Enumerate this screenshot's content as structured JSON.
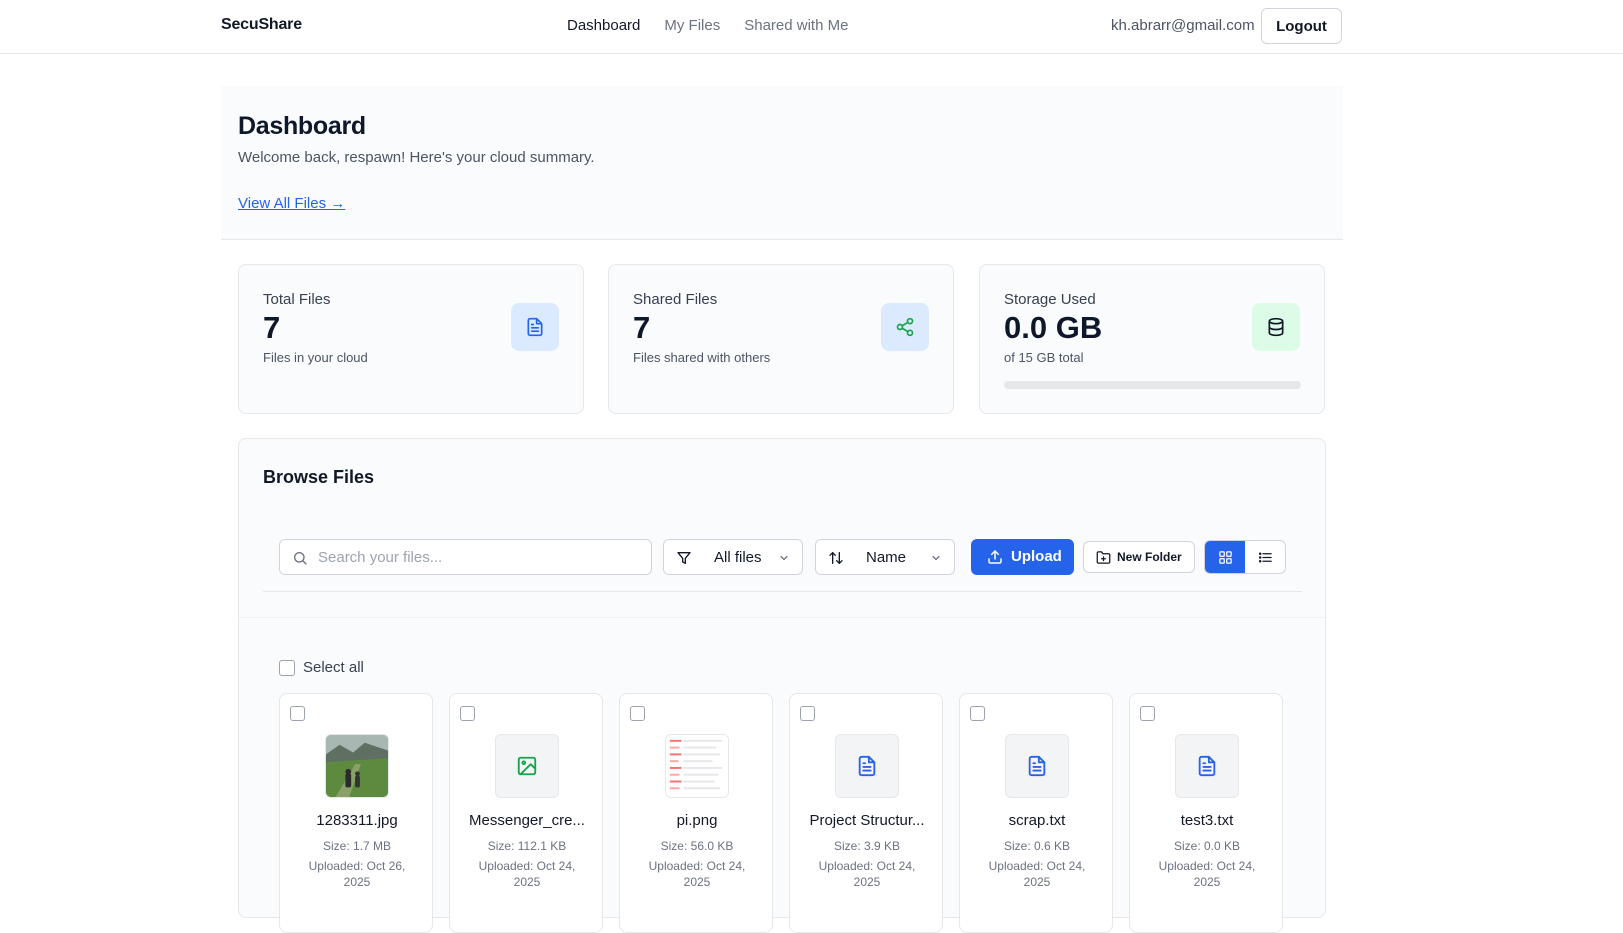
{
  "nav": {
    "brand": "SecuShare",
    "links": [
      "Dashboard",
      "My Files",
      "Shared with Me"
    ],
    "user_email": "kh.abrarr@gmail.com",
    "logout_label": "Logout"
  },
  "hero": {
    "title": "Dashboard",
    "subtitle": "Welcome back, respawn! Here's your cloud summary.",
    "view_all_link": "View All Files →"
  },
  "stats": [
    {
      "label": "Total Files",
      "value": "7",
      "hint": "Files in your cloud",
      "icon": "file-icon",
      "icon_bg": "#dbeafe",
      "icon_color": "#2563eb"
    },
    {
      "label": "Shared Files",
      "value": "7",
      "hint": "Files shared with others",
      "icon": "share-icon",
      "icon_bg": "#dbeafe",
      "icon_color": "#16a34a"
    },
    {
      "label": "Storage Used",
      "value": "0.0 GB",
      "hint": "of 15 GB total",
      "icon": "database-icon",
      "icon_bg": "#dcfce7",
      "icon_color": "#111827",
      "progress_fraction": 0.0
    }
  ],
  "browse": {
    "title": "Browse Files",
    "search_placeholder": "Search your files...",
    "filter_value": "All files",
    "sort_value": "Name",
    "upload_label": "Upload",
    "new_folder_label": "New Folder",
    "select_all_label": "Select all",
    "accent": "#2563eb"
  },
  "files": [
    {
      "name": "1283311.jpg",
      "size": "Size: 1.7 MB",
      "uploaded": "Uploaded: Oct 26, 2025",
      "thumb": "photo"
    },
    {
      "name": "Messenger_cre...",
      "size": "Size: 112.1 KB",
      "uploaded": "Uploaded: Oct 24, 2025",
      "thumb": "image-icon"
    },
    {
      "name": "pi.png",
      "size": "Size: 56.0 KB",
      "uploaded": "Uploaded: Oct 24, 2025",
      "thumb": "document-preview"
    },
    {
      "name": "Project Structur...",
      "size": "Size: 3.9 KB",
      "uploaded": "Uploaded: Oct 24, 2025",
      "thumb": "file-text-icon"
    },
    {
      "name": "scrap.txt",
      "size": "Size: 0.6 KB",
      "uploaded": "Uploaded: Oct 24, 2025",
      "thumb": "file-text-icon"
    },
    {
      "name": "test3.txt",
      "size": "Size: 0.0 KB",
      "uploaded": "Uploaded: Oct 24, 2025",
      "thumb": "file-text-icon"
    }
  ]
}
